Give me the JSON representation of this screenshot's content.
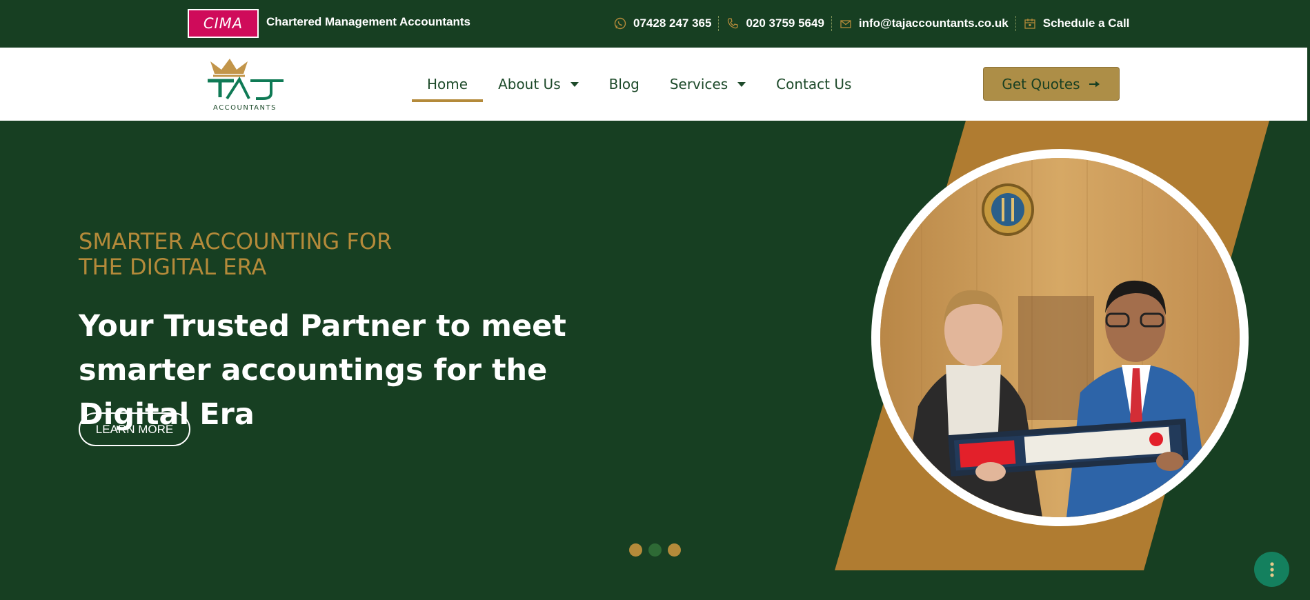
{
  "topbar": {
    "badge": "CIMA",
    "subtitle": "Chartered Management Accountants",
    "contacts": [
      {
        "icon": "whatsapp-icon",
        "text": "07428 247 365"
      },
      {
        "icon": "phone-icon",
        "text": "020 3759 5649"
      },
      {
        "icon": "email-icon",
        "text": "info@tajaccountants.co.uk"
      },
      {
        "icon": "calendar-icon",
        "text": "Schedule a Call"
      }
    ]
  },
  "logo": {
    "brand": "TAJ",
    "tagline": "ACCOUNTANTS"
  },
  "nav": {
    "items": [
      {
        "label": "Home",
        "dropdown": false,
        "active": true
      },
      {
        "label": "About Us",
        "dropdown": true,
        "active": false
      },
      {
        "label": "Blog",
        "dropdown": false,
        "active": false
      },
      {
        "label": "Services",
        "dropdown": true,
        "active": false
      },
      {
        "label": "Contact Us",
        "dropdown": false,
        "active": false
      }
    ],
    "cta": "Get Quotes"
  },
  "hero": {
    "kicker_line1": "SMARTER ACCOUNTING FOR",
    "kicker_line2": "THE DIGITAL ERA",
    "headline": "Your Trusted Partner to meet smarter accountings for the Digital Era",
    "button": "LEARN MORE",
    "slides": 3,
    "active_slide": 2
  },
  "colors": {
    "primary_green": "#173f22",
    "gold": "#b48a3a",
    "cima_pink": "#cf0b5a",
    "fab_teal": "#14805e"
  }
}
